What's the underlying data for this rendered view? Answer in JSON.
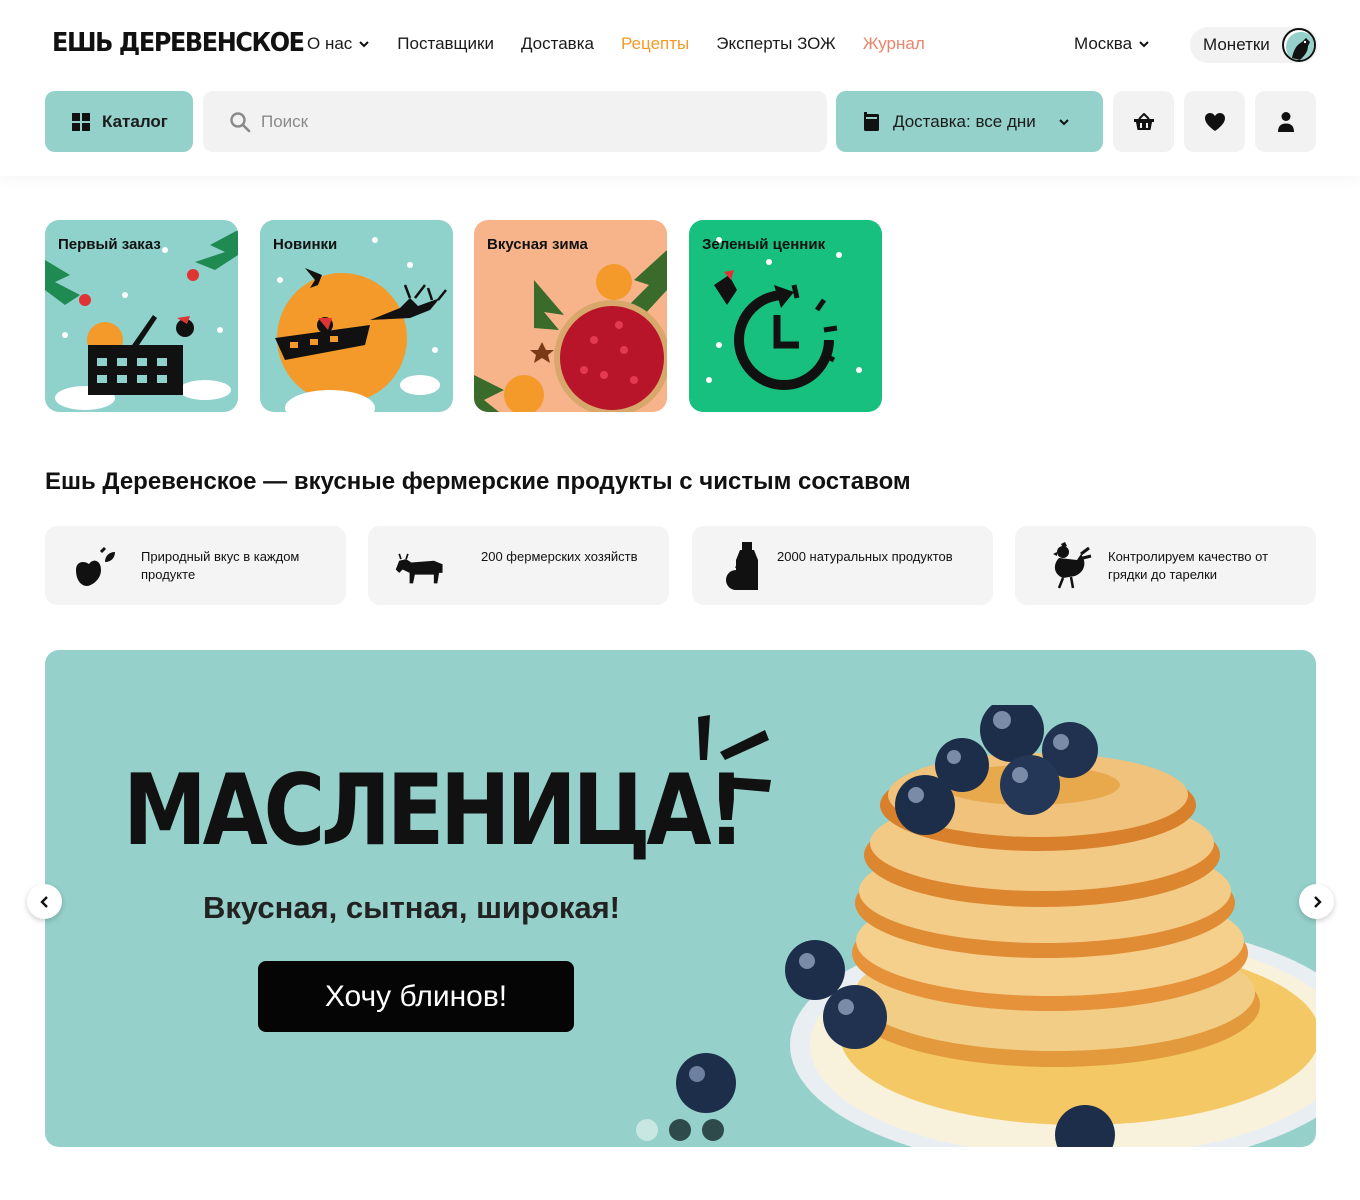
{
  "header": {
    "logo": "ЕШЬ ДЕРЕВЕНСКОЕ",
    "nav": [
      {
        "label": "О нас",
        "has_dropdown": true
      },
      {
        "label": "Поставщики"
      },
      {
        "label": "Доставка"
      },
      {
        "label": "Рецепты",
        "color": "#f39a2a"
      },
      {
        "label": "Эксперты ЗОЖ"
      },
      {
        "label": "Журнал",
        "color": "#e9856b"
      }
    ],
    "city": "Москва",
    "coins_label": "Монетки"
  },
  "toolbar": {
    "catalog_label": "Каталог",
    "search_placeholder": "Поиск",
    "delivery_label": "Доставка: все дни",
    "icons": [
      "basket-icon",
      "heart-icon",
      "user-icon"
    ]
  },
  "stories": [
    {
      "title": "Первый заказ",
      "bg": "#8fd1cb"
    },
    {
      "title": "Новинки",
      "bg": "#8fd1cb"
    },
    {
      "title": "Вкусная зима",
      "bg": "#f7b48a"
    },
    {
      "title": "Зеленый ценник",
      "bg": "#17c07f"
    }
  ],
  "main": {
    "heading": "Ешь Деревенское — вкусные фермерские продукты с чистым составом",
    "features": [
      {
        "text": "Природный вкус в каждом продукте",
        "icon": "sprout-icon"
      },
      {
        "text": "200 фермерских хозяйств",
        "icon": "cow-icon"
      },
      {
        "text": "2000 натуральных продуктов",
        "icon": "milk-bottle-icon"
      },
      {
        "text": "Контролируем качество от грядки до тарелки",
        "icon": "rooster-icon"
      }
    ]
  },
  "banner": {
    "title": "МАСЛЕНИЦА!",
    "subtitle": "Вкусная, сытная, широкая!",
    "cta": "Хочу блинов!",
    "bg": "#95d0ca",
    "slides_count": 3,
    "active_slide": 1
  }
}
